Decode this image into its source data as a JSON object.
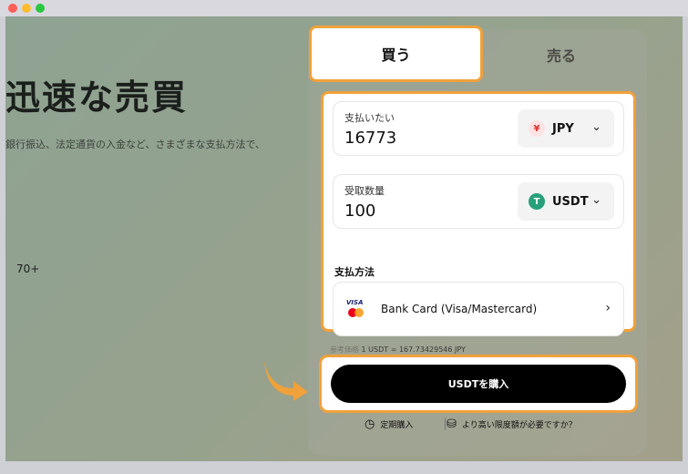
{
  "hero": {
    "title": "迅速な売買",
    "subtitle": "銀行振込、法定通貨の入金など、さまざまな支払方法で、",
    "count": "70+"
  },
  "tabs": {
    "buy": "買う",
    "sell": "売る"
  },
  "pay_field": {
    "label": "支払いたい",
    "value": "16773",
    "currency": "JPY",
    "currency_symbol": "¥",
    "icon": "yen-icon"
  },
  "receive_field": {
    "label": "受取数量",
    "value": "100",
    "currency": "USDT",
    "currency_symbol": "T",
    "icon": "tether-icon"
  },
  "payment": {
    "label": "支払方法",
    "method": "Bank Card (Visa/Mastercard)",
    "brand_text": "VISA"
  },
  "rate": {
    "label": "参考価格",
    "value": "1 USDT = 167.73429546 JPY"
  },
  "buy_button": "USDTを購入",
  "footer": {
    "recurring": "定期購入",
    "higher_limit": "より高い限度額が必要ですか？"
  },
  "colors": {
    "highlight": "#f0a13a",
    "usdt": "#26a17b",
    "jpy": "#d33333",
    "button": "#000000"
  }
}
